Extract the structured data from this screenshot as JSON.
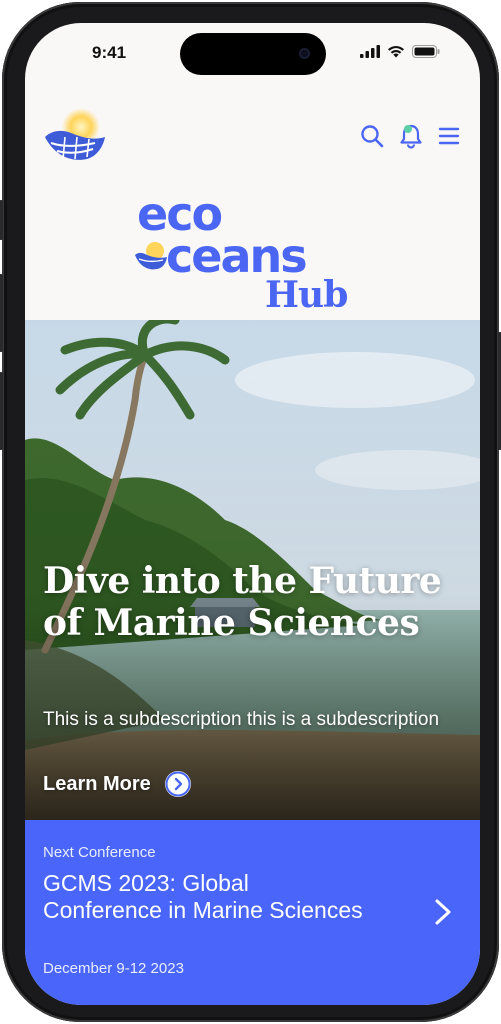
{
  "status_bar": {
    "time": "9:41"
  },
  "brand": {
    "line1": "eco",
    "line2": "ceans",
    "line3": "Hub"
  },
  "header": {
    "icons": [
      "logo-icon",
      "search-icon",
      "bell-icon",
      "menu-icon"
    ]
  },
  "hero": {
    "title": "Dive into the Future of Marine Sciences",
    "subtitle": "This is a subdescription this is a subdescription",
    "cta_label": "Learn More"
  },
  "conference": {
    "kicker": "Next Conference",
    "title": "GCMS 2023: Global Conference in Marine Sciences",
    "date": "December 9-12 2023"
  },
  "colors": {
    "accent": "#4a66f2",
    "banner": "#4a66fa",
    "background": "#faf8f6"
  }
}
